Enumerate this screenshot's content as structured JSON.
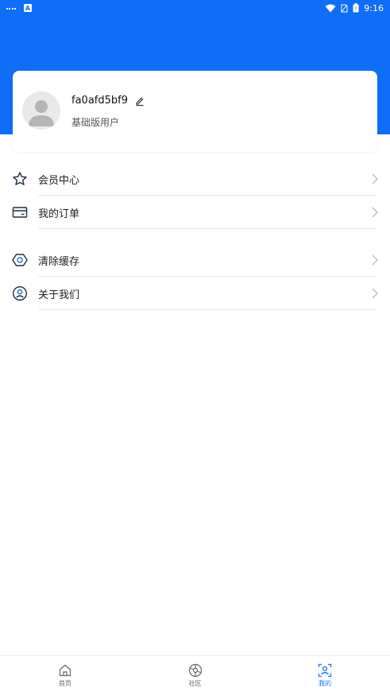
{
  "status_bar": {
    "time": "9:16"
  },
  "profile": {
    "username": "fa0afd5bf9",
    "level": "基础版用户"
  },
  "menu_group_1": [
    {
      "label": "会员中心",
      "icon": "star-icon"
    },
    {
      "label": "我的订单",
      "icon": "card-icon"
    }
  ],
  "menu_group_2": [
    {
      "label": "清除缓存",
      "icon": "hexagon-icon"
    },
    {
      "label": "关于我们",
      "icon": "user-circle-icon"
    }
  ],
  "bottom_nav": {
    "items": [
      {
        "label": "首页",
        "icon": "home-icon",
        "active": false
      },
      {
        "label": "社区",
        "icon": "community-icon",
        "active": false
      },
      {
        "label": "我的",
        "icon": "profile-scan-icon",
        "active": true
      }
    ]
  },
  "colors": {
    "primary": "#0f6df7",
    "active_tab": "#1677ff",
    "divider": "#e8e8e8"
  }
}
